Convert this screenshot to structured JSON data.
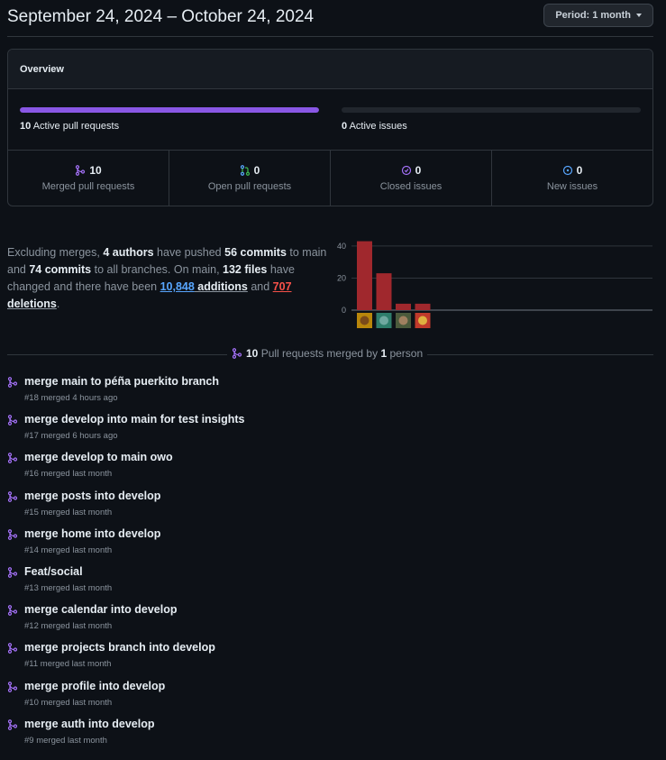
{
  "header": {
    "title": "September 24, 2024 – October 24, 2024",
    "period_prefix": "Period:",
    "period_value": "1 month"
  },
  "overview": {
    "title": "Overview",
    "active_prs_count": "10",
    "active_prs_label": "Active pull requests",
    "active_prs_fill": 1.0,
    "active_issues_count": "0",
    "active_issues_label": "Active issues",
    "active_issues_fill": 0.0,
    "stats": [
      {
        "count": "10",
        "label": "Merged pull requests",
        "icon": "git-merge-icon",
        "color": "#a371f7"
      },
      {
        "count": "0",
        "label": "Open pull requests",
        "icon": "git-pull-request-icon",
        "color": "#3fb950"
      },
      {
        "count": "0",
        "label": "Closed issues",
        "icon": "issue-closed-icon",
        "color": "#a371f7"
      },
      {
        "count": "0",
        "label": "New issues",
        "icon": "issue-opened-icon",
        "color": "#58a6ff"
      }
    ]
  },
  "summary": {
    "t1": "Excluding merges, ",
    "authors": "4 authors",
    "t2": " have pushed ",
    "commits_main": "56 commits",
    "t3": " to main and ",
    "commits_all": "74 commits",
    "t4": " to all branches. On main, ",
    "files": "132 files",
    "t5": " have changed and there have been ",
    "additions_num": "10,848",
    "additions_word": " additions",
    "t6": " and ",
    "deletions_num": "707",
    "deletions_word": " deletions",
    "t7": "."
  },
  "chart_data": {
    "type": "bar",
    "categories": [
      "author-1",
      "author-2",
      "author-3",
      "author-4"
    ],
    "values": [
      43,
      23,
      4,
      4
    ],
    "ylim": [
      0,
      45
    ],
    "yticks": [
      "0",
      "20",
      "40"
    ],
    "ytick_values": [
      0,
      20,
      40
    ],
    "bar_color": "#a0282d",
    "grid": true
  },
  "merged": {
    "count": "10",
    "t1": " Pull requests merged by ",
    "people": "1",
    "t2": " person"
  },
  "prs": [
    {
      "title": "merge main to péña puerkito branch",
      "meta": "#18 merged 4 hours ago"
    },
    {
      "title": "merge develop into main for test insights",
      "meta": "#17 merged 6 hours ago"
    },
    {
      "title": "merge develop to main owo",
      "meta": "#16 merged last month"
    },
    {
      "title": "merge posts into develop",
      "meta": "#15 merged last month"
    },
    {
      "title": "merge home into develop",
      "meta": "#14 merged last month"
    },
    {
      "title": "Feat/social",
      "meta": "#13 merged last month"
    },
    {
      "title": "merge calendar into develop",
      "meta": "#12 merged last month"
    },
    {
      "title": "merge projects branch into develop",
      "meta": "#11 merged last month"
    },
    {
      "title": "merge profile into develop",
      "meta": "#10 merged last month"
    },
    {
      "title": "merge auth into develop",
      "meta": "#9 merged last month"
    }
  ]
}
